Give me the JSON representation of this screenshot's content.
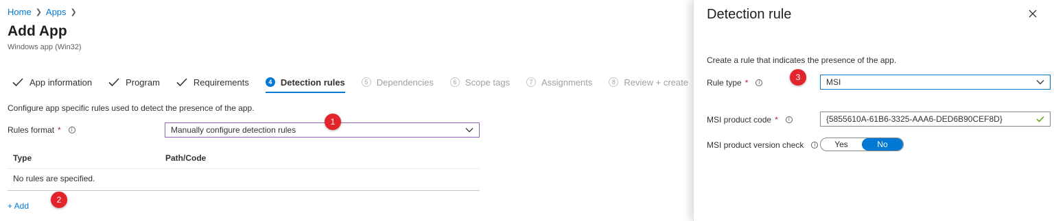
{
  "breadcrumb": {
    "home": "Home",
    "apps": "Apps"
  },
  "page": {
    "title": "Add App",
    "subtitle": "Windows app (Win32)"
  },
  "tabs": [
    {
      "label": "App information",
      "state": "done"
    },
    {
      "label": "Program",
      "state": "done"
    },
    {
      "label": "Requirements",
      "state": "done"
    },
    {
      "number": "4",
      "label": "Detection rules",
      "state": "active"
    },
    {
      "number": "5",
      "label": "Dependencies",
      "state": "disabled"
    },
    {
      "number": "6",
      "label": "Scope tags",
      "state": "disabled"
    },
    {
      "number": "7",
      "label": "Assignments",
      "state": "disabled"
    },
    {
      "number": "8",
      "label": "Review + create",
      "state": "disabled"
    }
  ],
  "main": {
    "description": "Configure app specific rules used to detect the presence of the app.",
    "rules_format": {
      "label": "Rules format",
      "required_mark": "*",
      "value": "Manually configure detection rules"
    },
    "table": {
      "columns": [
        "Type",
        "Path/Code"
      ],
      "empty_text": "No rules are specified."
    },
    "add_link": "+ Add"
  },
  "badges": [
    "1",
    "2",
    "3"
  ],
  "panel": {
    "title": "Detection rule",
    "description": "Create a rule that indicates the presence of the app.",
    "rule_type": {
      "label": "Rule type",
      "required_mark": "*",
      "value": "MSI"
    },
    "product_code": {
      "label": "MSI product code",
      "required_mark": "*",
      "value": "{5855610A-61B6-3325-AAA6-DED6B90CEF8D}"
    },
    "version_check": {
      "label": "MSI product version check",
      "yes": "Yes",
      "no": "No",
      "selected": "No"
    }
  },
  "colors": {
    "accent": "#0078d4",
    "badge": "#e3242b",
    "required": "#a4262c",
    "valid_check": "#57a300"
  },
  "icons": [
    "chevron-right-icon",
    "checkmark-icon",
    "info-icon",
    "chevron-down-icon",
    "close-icon"
  ]
}
